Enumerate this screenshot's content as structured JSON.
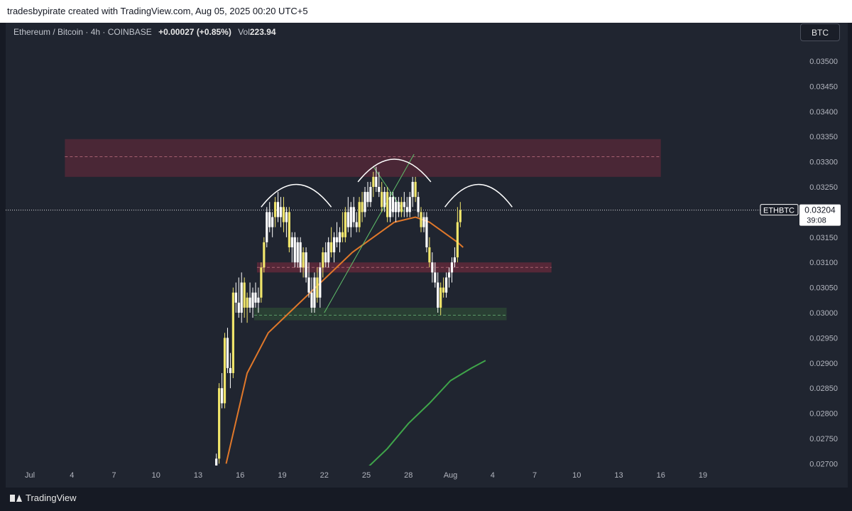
{
  "header": {
    "attribution": "tradesbypirate created with TradingView.com, Aug 05, 2025 00:20 UTC+5"
  },
  "legend": {
    "symbol": "Ethereum / Bitcoin · 4h · COINBASE",
    "change": "+0.00027 (+0.85%)",
    "vol_label": "Vol",
    "vol_value": "223.94"
  },
  "currency_button": "BTC",
  "footer": {
    "brand": "TradingView"
  },
  "colors": {
    "background": "#202530",
    "candle": "#ffffff",
    "candle_alt": "#f0e56b",
    "ema_short": "#e0782a",
    "ema_long": "#3fa54a",
    "resistance_zone": "#6e2a3c",
    "demand_zone": "#2e4a34",
    "label_bg": "#ffffff"
  },
  "chart_data": {
    "type": "candlestick",
    "symbol": "ETHBTC",
    "last_price": "0.03204",
    "countdown": "39:08",
    "y_ticks": [
      "0.03500",
      "0.03450",
      "0.03400",
      "0.03350",
      "0.03300",
      "0.03250",
      "0.03200",
      "0.03150",
      "0.03100",
      "0.03050",
      "0.03000",
      "0.02950",
      "0.02900",
      "0.02850",
      "0.02800",
      "0.02750",
      "0.02700"
    ],
    "ylim": [
      0.0269,
      0.0354
    ],
    "x_ticks": [
      "28",
      "Jul",
      "4",
      "7",
      "10",
      "13",
      "16",
      "19",
      "22",
      "25",
      "28",
      "Aug",
      "4",
      "7",
      "10",
      "13",
      "16",
      "19"
    ],
    "start_day": "Jun 25, 2025",
    "candles": [
      {
        "day": 16.3,
        "o": 0.0265,
        "h": 0.0272,
        "l": 0.0264,
        "c": 0.0271
      },
      {
        "day": 16.5,
        "o": 0.0271,
        "h": 0.0286,
        "l": 0.027,
        "c": 0.0285
      },
      {
        "day": 16.7,
        "o": 0.0285,
        "h": 0.0288,
        "l": 0.0281,
        "c": 0.0282
      },
      {
        "day": 16.9,
        "o": 0.0282,
        "h": 0.0296,
        "l": 0.0281,
        "c": 0.0295
      },
      {
        "day": 17.1,
        "o": 0.0295,
        "h": 0.0297,
        "l": 0.0288,
        "c": 0.0289
      },
      {
        "day": 17.3,
        "o": 0.0289,
        "h": 0.0292,
        "l": 0.0285,
        "c": 0.0288
      },
      {
        "day": 17.5,
        "o": 0.0288,
        "h": 0.0305,
        "l": 0.0287,
        "c": 0.0304
      },
      {
        "day": 17.7,
        "o": 0.0304,
        "h": 0.0306,
        "l": 0.03,
        "c": 0.0302
      },
      {
        "day": 17.9,
        "o": 0.0302,
        "h": 0.0307,
        "l": 0.0299,
        "c": 0.03
      },
      {
        "day": 18.1,
        "o": 0.03,
        "h": 0.0308,
        "l": 0.0298,
        "c": 0.0306
      },
      {
        "day": 18.3,
        "o": 0.0306,
        "h": 0.0307,
        "l": 0.0299,
        "c": 0.0301
      },
      {
        "day": 18.5,
        "o": 0.0301,
        "h": 0.0304,
        "l": 0.0298,
        "c": 0.0303
      },
      {
        "day": 18.7,
        "o": 0.0303,
        "h": 0.0306,
        "l": 0.03,
        "c": 0.0301
      },
      {
        "day": 18.9,
        "o": 0.0301,
        "h": 0.0305,
        "l": 0.0299,
        "c": 0.0304
      },
      {
        "day": 19.1,
        "o": 0.0304,
        "h": 0.0306,
        "l": 0.0301,
        "c": 0.0302
      },
      {
        "day": 19.3,
        "o": 0.0302,
        "h": 0.0305,
        "l": 0.03,
        "c": 0.0303
      },
      {
        "day": 19.5,
        "o": 0.0303,
        "h": 0.031,
        "l": 0.0302,
        "c": 0.0309
      },
      {
        "day": 19.7,
        "o": 0.0309,
        "h": 0.0315,
        "l": 0.0308,
        "c": 0.0314
      },
      {
        "day": 19.9,
        "o": 0.0314,
        "h": 0.0321,
        "l": 0.0313,
        "c": 0.032
      },
      {
        "day": 20.1,
        "o": 0.032,
        "h": 0.0322,
        "l": 0.0316,
        "c": 0.0317
      },
      {
        "day": 20.3,
        "o": 0.0317,
        "h": 0.032,
        "l": 0.0315,
        "c": 0.0319
      },
      {
        "day": 20.5,
        "o": 0.0319,
        "h": 0.0323,
        "l": 0.0317,
        "c": 0.0322
      },
      {
        "day": 20.7,
        "o": 0.0322,
        "h": 0.0324,
        "l": 0.0318,
        "c": 0.0319
      },
      {
        "day": 20.9,
        "o": 0.0319,
        "h": 0.0323,
        "l": 0.0317,
        "c": 0.0321
      },
      {
        "day": 21.1,
        "o": 0.0321,
        "h": 0.0323,
        "l": 0.0316,
        "c": 0.0318
      },
      {
        "day": 21.3,
        "o": 0.0318,
        "h": 0.0321,
        "l": 0.0315,
        "c": 0.032
      },
      {
        "day": 21.5,
        "o": 0.032,
        "h": 0.0321,
        "l": 0.0312,
        "c": 0.0313
      },
      {
        "day": 21.7,
        "o": 0.0313,
        "h": 0.0316,
        "l": 0.031,
        "c": 0.0315
      },
      {
        "day": 21.9,
        "o": 0.0315,
        "h": 0.0316,
        "l": 0.0309,
        "c": 0.031
      },
      {
        "day": 22.1,
        "o": 0.031,
        "h": 0.0315,
        "l": 0.0309,
        "c": 0.0314
      },
      {
        "day": 22.3,
        "o": 0.0314,
        "h": 0.0315,
        "l": 0.0308,
        "c": 0.0309
      },
      {
        "day": 22.5,
        "o": 0.0309,
        "h": 0.0313,
        "l": 0.0307,
        "c": 0.0312
      },
      {
        "day": 22.7,
        "o": 0.0312,
        "h": 0.0313,
        "l": 0.0306,
        "c": 0.0307
      },
      {
        "day": 22.9,
        "o": 0.0307,
        "h": 0.031,
        "l": 0.0303,
        "c": 0.0304
      },
      {
        "day": 23.1,
        "o": 0.0304,
        "h": 0.0307,
        "l": 0.03,
        "c": 0.0301
      },
      {
        "day": 23.3,
        "o": 0.0301,
        "h": 0.0308,
        "l": 0.03,
        "c": 0.0307
      },
      {
        "day": 23.5,
        "o": 0.0307,
        "h": 0.0309,
        "l": 0.0302,
        "c": 0.0303
      },
      {
        "day": 23.7,
        "o": 0.0303,
        "h": 0.031,
        "l": 0.0301,
        "c": 0.0309
      },
      {
        "day": 23.9,
        "o": 0.0309,
        "h": 0.0313,
        "l": 0.0307,
        "c": 0.0312
      },
      {
        "day": 24.1,
        "o": 0.0312,
        "h": 0.0314,
        "l": 0.0309,
        "c": 0.031
      },
      {
        "day": 24.3,
        "o": 0.031,
        "h": 0.0315,
        "l": 0.0309,
        "c": 0.0314
      },
      {
        "day": 24.5,
        "o": 0.0314,
        "h": 0.0317,
        "l": 0.0311,
        "c": 0.0312
      },
      {
        "day": 24.7,
        "o": 0.0312,
        "h": 0.0316,
        "l": 0.031,
        "c": 0.0315
      },
      {
        "day": 24.9,
        "o": 0.0315,
        "h": 0.0318,
        "l": 0.0313,
        "c": 0.0314
      },
      {
        "day": 25.1,
        "o": 0.0314,
        "h": 0.0317,
        "l": 0.0312,
        "c": 0.0316
      },
      {
        "day": 25.3,
        "o": 0.0316,
        "h": 0.032,
        "l": 0.0314,
        "c": 0.0315
      },
      {
        "day": 25.5,
        "o": 0.0315,
        "h": 0.0321,
        "l": 0.0314,
        "c": 0.032
      },
      {
        "day": 25.7,
        "o": 0.032,
        "h": 0.0323,
        "l": 0.0316,
        "c": 0.0317
      },
      {
        "day": 25.9,
        "o": 0.0317,
        "h": 0.0322,
        "l": 0.0315,
        "c": 0.0321
      },
      {
        "day": 26.1,
        "o": 0.0321,
        "h": 0.0323,
        "l": 0.0317,
        "c": 0.0318
      },
      {
        "day": 26.3,
        "o": 0.0318,
        "h": 0.032,
        "l": 0.0316,
        "c": 0.0317
      },
      {
        "day": 26.5,
        "o": 0.0317,
        "h": 0.0323,
        "l": 0.0316,
        "c": 0.0322
      },
      {
        "day": 26.7,
        "o": 0.0322,
        "h": 0.0324,
        "l": 0.0318,
        "c": 0.032
      },
      {
        "day": 26.9,
        "o": 0.032,
        "h": 0.0325,
        "l": 0.0319,
        "c": 0.0324
      },
      {
        "day": 27.1,
        "o": 0.0324,
        "h": 0.0326,
        "l": 0.0321,
        "c": 0.0322
      },
      {
        "day": 27.3,
        "o": 0.0322,
        "h": 0.0326,
        "l": 0.0321,
        "c": 0.0325
      },
      {
        "day": 27.5,
        "o": 0.0325,
        "h": 0.0328,
        "l": 0.0323,
        "c": 0.0327
      },
      {
        "day": 27.7,
        "o": 0.0327,
        "h": 0.0329,
        "l": 0.0324,
        "c": 0.0325
      },
      {
        "day": 27.9,
        "o": 0.0325,
        "h": 0.0328,
        "l": 0.0323,
        "c": 0.0324
      },
      {
        "day": 28.1,
        "o": 0.0324,
        "h": 0.0326,
        "l": 0.032,
        "c": 0.0321
      },
      {
        "day": 28.3,
        "o": 0.0321,
        "h": 0.0325,
        "l": 0.032,
        "c": 0.0324
      },
      {
        "day": 28.5,
        "o": 0.0324,
        "h": 0.0325,
        "l": 0.0318,
        "c": 0.0319
      },
      {
        "day": 28.7,
        "o": 0.0319,
        "h": 0.0324,
        "l": 0.0318,
        "c": 0.0323
      },
      {
        "day": 28.9,
        "o": 0.0323,
        "h": 0.0324,
        "l": 0.0319,
        "c": 0.032
      },
      {
        "day": 29.1,
        "o": 0.032,
        "h": 0.0323,
        "l": 0.0318,
        "c": 0.0322
      },
      {
        "day": 29.3,
        "o": 0.0322,
        "h": 0.0323,
        "l": 0.0319,
        "c": 0.032
      },
      {
        "day": 29.5,
        "o": 0.032,
        "h": 0.0323,
        "l": 0.0319,
        "c": 0.0322
      },
      {
        "day": 29.7,
        "o": 0.0322,
        "h": 0.0324,
        "l": 0.0319,
        "c": 0.0321
      },
      {
        "day": 29.9,
        "o": 0.0321,
        "h": 0.0323,
        "l": 0.0319,
        "c": 0.032
      },
      {
        "day": 30.1,
        "o": 0.032,
        "h": 0.0324,
        "l": 0.0319,
        "c": 0.0323
      },
      {
        "day": 30.3,
        "o": 0.0323,
        "h": 0.0327,
        "l": 0.0321,
        "c": 0.0326
      },
      {
        "day": 30.5,
        "o": 0.0326,
        "h": 0.0327,
        "l": 0.0322,
        "c": 0.0323
      },
      {
        "day": 30.7,
        "o": 0.0323,
        "h": 0.0324,
        "l": 0.0319,
        "c": 0.032
      },
      {
        "day": 30.9,
        "o": 0.032,
        "h": 0.0321,
        "l": 0.0316,
        "c": 0.0317
      },
      {
        "day": 31.1,
        "o": 0.0317,
        "h": 0.032,
        "l": 0.0316,
        "c": 0.0319
      },
      {
        "day": 31.3,
        "o": 0.0319,
        "h": 0.032,
        "l": 0.0312,
        "c": 0.0313
      },
      {
        "day": 31.5,
        "o": 0.0313,
        "h": 0.0315,
        "l": 0.0309,
        "c": 0.031
      },
      {
        "day": 31.7,
        "o": 0.031,
        "h": 0.0312,
        "l": 0.0306,
        "c": 0.0308
      },
      {
        "day": 31.9,
        "o": 0.0308,
        "h": 0.031,
        "l": 0.0305,
        "c": 0.0306
      },
      {
        "day": 32.1,
        "o": 0.0306,
        "h": 0.0308,
        "l": 0.03,
        "c": 0.0301
      },
      {
        "day": 32.3,
        "o": 0.0301,
        "h": 0.0306,
        "l": 0.02995,
        "c": 0.0305
      },
      {
        "day": 32.5,
        "o": 0.0305,
        "h": 0.0307,
        "l": 0.0303,
        "c": 0.0304
      },
      {
        "day": 32.7,
        "o": 0.0304,
        "h": 0.0308,
        "l": 0.0303,
        "c": 0.0307
      },
      {
        "day": 32.9,
        "o": 0.0307,
        "h": 0.0309,
        "l": 0.0305,
        "c": 0.0308
      },
      {
        "day": 33.1,
        "o": 0.0308,
        "h": 0.0311,
        "l": 0.0306,
        "c": 0.031
      },
      {
        "day": 33.3,
        "o": 0.031,
        "h": 0.0313,
        "l": 0.0309,
        "c": 0.0311
      },
      {
        "day": 33.5,
        "o": 0.0311,
        "h": 0.0321,
        "l": 0.031,
        "c": 0.0318
      },
      {
        "day": 33.7,
        "o": 0.0318,
        "h": 0.0322,
        "l": 0.0317,
        "c": 0.03204
      }
    ],
    "ema_short": [
      [
        17.0,
        0.027
      ],
      [
        18.5,
        0.0288
      ],
      [
        20.0,
        0.0296
      ],
      [
        21.5,
        0.03
      ],
      [
        23.0,
        0.0304
      ],
      [
        24.5,
        0.0308
      ],
      [
        26.0,
        0.0312
      ],
      [
        27.5,
        0.0315
      ],
      [
        29.0,
        0.0318
      ],
      [
        30.5,
        0.0319
      ],
      [
        31.5,
        0.0318
      ],
      [
        32.5,
        0.0316
      ],
      [
        33.5,
        0.0314
      ],
      [
        33.9,
        0.0313
      ]
    ],
    "ema_long": [
      [
        27.0,
        0.0269
      ],
      [
        28.5,
        0.0273
      ],
      [
        30.0,
        0.0278
      ],
      [
        31.5,
        0.0282
      ],
      [
        33.0,
        0.02865
      ],
      [
        34.5,
        0.0289
      ],
      [
        35.5,
        0.02905
      ]
    ],
    "zones": [
      {
        "name": "resistance",
        "y0": 0.0327,
        "y1": 0.03345,
        "x0": 5.5,
        "x1": 48.0,
        "mid": 0.0331
      },
      {
        "name": "mid-resistance",
        "y0": 0.0308,
        "y1": 0.031,
        "x0": 19.2,
        "x1": 40.2,
        "mid": 0.0309
      },
      {
        "name": "demand",
        "y0": 0.02985,
        "y1": 0.0301,
        "x0": 19.0,
        "x1": 37.0,
        "mid": 0.02995
      }
    ],
    "trendline": [
      [
        24.0,
        0.03
      ],
      [
        30.4,
        0.03315
      ]
    ],
    "trendline_inner": [
      [
        27.5,
        0.0329
      ],
      [
        29.7,
        0.032
      ]
    ],
    "arcs": [
      {
        "center": 22.0,
        "peak": 0.03255,
        "width": 2.5,
        "drop": 0.00045
      },
      {
        "center": 29.0,
        "peak": 0.03305,
        "width": 2.6,
        "drop": 0.00045
      },
      {
        "center": 35.0,
        "peak": 0.03255,
        "width": 2.4,
        "drop": 0.00045
      }
    ]
  }
}
